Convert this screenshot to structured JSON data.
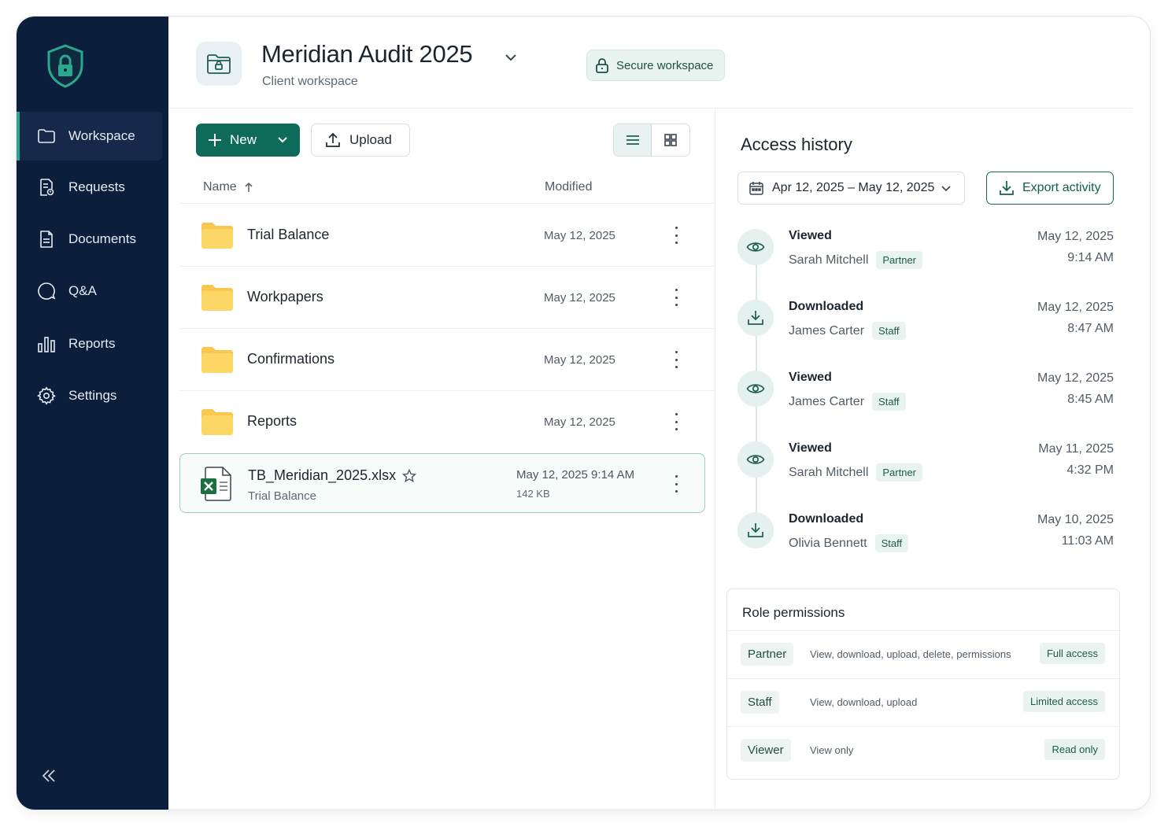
{
  "sidebar": {
    "items": [
      {
        "label": "Workspace",
        "icon": "folder-icon",
        "active": true
      },
      {
        "label": "Requests",
        "icon": "request-icon"
      },
      {
        "label": "Documents",
        "icon": "document-icon"
      },
      {
        "label": "Q&A",
        "icon": "chat-icon"
      },
      {
        "label": "Reports",
        "icon": "bar-chart-icon"
      },
      {
        "label": "Settings",
        "icon": "gear-icon"
      }
    ]
  },
  "header": {
    "title": "Meridian Audit 2025",
    "subtitle": "Client workspace",
    "secure_label": "Secure workspace"
  },
  "toolbar": {
    "new_label": "New",
    "upload_label": "Upload"
  },
  "list": {
    "col_name": "Name",
    "col_modified": "Modified",
    "folders": [
      {
        "name": "Trial Balance",
        "modified": "May 12, 2025"
      },
      {
        "name": "Workpapers",
        "modified": "May 12, 2025"
      },
      {
        "name": "Confirmations",
        "modified": "May 12, 2025"
      },
      {
        "name": "Reports",
        "modified": "May 12, 2025"
      }
    ],
    "file": {
      "name": "TB_Meridian_2025.xlsx",
      "folder": "Trial Balance",
      "modified": "May 12, 2025 9:14 AM",
      "size": "142 KB"
    }
  },
  "access": {
    "title": "Access history",
    "date_range": "Apr 12, 2025 – May 12, 2025",
    "export_label": "Export activity",
    "events": [
      {
        "action": "Viewed",
        "user": "Sarah Mitchell",
        "role": "Partner",
        "date": "May 12, 2025",
        "time": "9:14 AM",
        "icon": "eye-icon"
      },
      {
        "action": "Downloaded",
        "user": "James Carter",
        "role": "Staff",
        "date": "May 12, 2025",
        "time": "8:47 AM",
        "icon": "download-icon"
      },
      {
        "action": "Viewed",
        "user": "James Carter",
        "role": "Staff",
        "date": "May 12, 2025",
        "time": "8:45 AM",
        "icon": "eye-icon"
      },
      {
        "action": "Viewed",
        "user": "Sarah Mitchell",
        "role": "Partner",
        "date": "May 11, 2025",
        "time": "4:32 PM",
        "icon": "eye-icon"
      },
      {
        "action": "Downloaded",
        "user": "Olivia Bennett",
        "role": "Staff",
        "date": "May 10, 2025",
        "time": "11:03 AM",
        "icon": "download-icon"
      }
    ]
  },
  "roles": {
    "title": "Role permissions",
    "items": [
      {
        "name": "Partner",
        "desc": "View, download, upload, delete, permissions",
        "level": "Full access"
      },
      {
        "name": "Staff",
        "desc": "View, download, upload",
        "level": "Limited access"
      },
      {
        "name": "Viewer",
        "desc": "View only",
        "level": "Read only"
      }
    ]
  },
  "colors": {
    "sidebar_bg": "#0b1e3b",
    "accent": "#0f6b59",
    "folder": "#f9c74f"
  }
}
